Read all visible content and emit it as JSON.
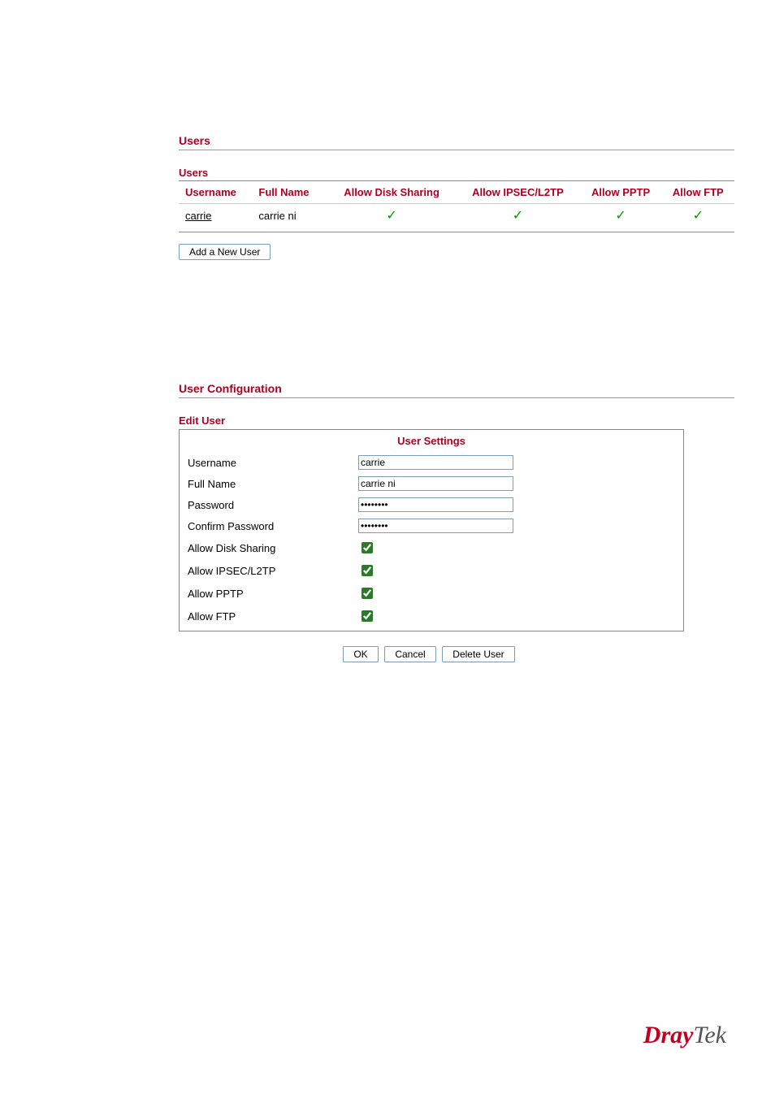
{
  "users_section": {
    "title": "Users",
    "table_title": "Users",
    "headers": {
      "username": "Username",
      "fullname": "Full Name",
      "disk": "Allow Disk Sharing",
      "ipsec": "Allow IPSEC/L2TP",
      "pptp": "Allow PPTP",
      "ftp": "Allow FTP"
    },
    "row": {
      "username": "carrie",
      "fullname": "carrie ni",
      "disk": true,
      "ipsec": true,
      "pptp": true,
      "ftp": true
    },
    "add_button": "Add a New User"
  },
  "config_section": {
    "title": "User Configuration",
    "edit_title": "Edit User",
    "box_title": "User Settings",
    "labels": {
      "username": "Username",
      "fullname": "Full Name",
      "password": "Password",
      "confirm": "Confirm Password",
      "disk": "Allow Disk Sharing",
      "ipsec": "Allow IPSEC/L2TP",
      "pptp": "Allow PPTP",
      "ftp": "Allow FTP"
    },
    "values": {
      "username": "carrie",
      "fullname": "carrie ni",
      "password": "••••••••",
      "confirm": "••••••••",
      "disk": true,
      "ipsec": true,
      "pptp": true,
      "ftp": true
    },
    "buttons": {
      "ok": "OK",
      "cancel": "Cancel",
      "delete": "Delete User"
    }
  },
  "logo": {
    "part1": "Dray",
    "part2": "Tek"
  }
}
